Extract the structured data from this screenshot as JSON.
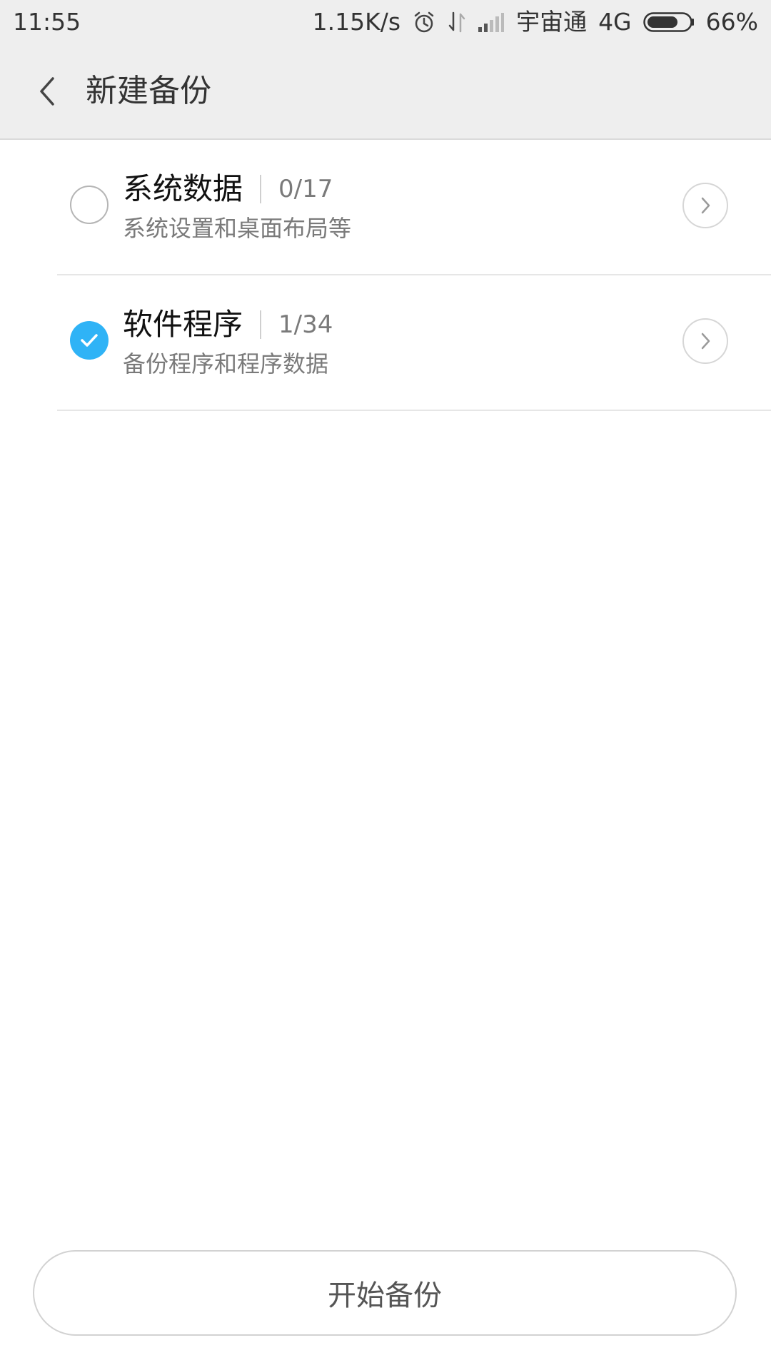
{
  "status_bar": {
    "time": "11:55",
    "network_speed": "1.15K/s",
    "carrier": "宇宙通",
    "network_type": "4G",
    "battery": "66%",
    "icons": [
      "alarm-icon",
      "data-transfer-icon",
      "signal-icon",
      "battery-icon"
    ]
  },
  "header": {
    "title": "新建备份"
  },
  "list": {
    "items": [
      {
        "title": "系统数据",
        "count": "0/17",
        "subtitle": "系统设置和桌面布局等",
        "checked": false
      },
      {
        "title": "软件程序",
        "count": "1/34",
        "subtitle": "备份程序和程序数据",
        "checked": true
      }
    ]
  },
  "footer": {
    "start_button_label": "开始备份"
  },
  "colors": {
    "accent": "#2fb3f6",
    "bar_background": "#eeeeee"
  }
}
